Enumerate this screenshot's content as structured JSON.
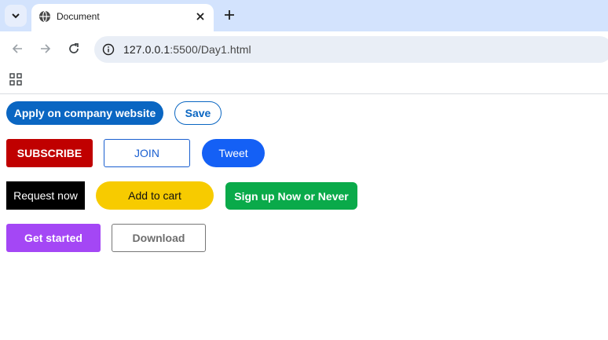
{
  "browser": {
    "tab": {
      "title": "Document"
    },
    "address_bar": {
      "url_host": "127.0.0.1",
      "url_rest": ":5500/Day1.html"
    },
    "colors": {
      "tabstrip": "#d3e3fd",
      "omnibox": "#e9eef6"
    }
  },
  "page": {
    "buttons": {
      "apply": {
        "label": "Apply on company website",
        "color": "#0a66c2"
      },
      "save": {
        "label": "Save",
        "color": "#0a66c2"
      },
      "subscribe": {
        "label": "SUBSCRIBE",
        "color": "#c00000"
      },
      "join": {
        "label": "JOIN",
        "color": "#1a5fd0"
      },
      "tweet": {
        "label": "Tweet",
        "color": "#1460f5"
      },
      "request": {
        "label": "Request now",
        "color": "#000000"
      },
      "cart": {
        "label": "Add to cart",
        "color": "#f7cb00"
      },
      "signup": {
        "label": "Sign up Now or Never",
        "color": "#0aaa4a"
      },
      "getstarted": {
        "label": "Get started",
        "color": "#a447f5"
      },
      "download": {
        "label": "Download",
        "color": "#777777"
      }
    }
  }
}
